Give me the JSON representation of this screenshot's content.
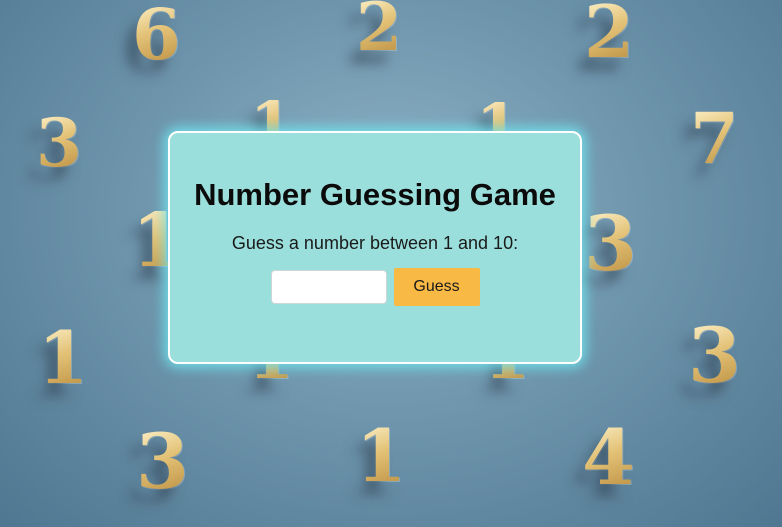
{
  "game": {
    "title": "Number Guessing Game",
    "prompt": "Guess a number between 1 and 10:",
    "input_value": "",
    "input_placeholder": "",
    "button_label": "Guess"
  },
  "background": {
    "digits": [
      "6",
      "2",
      "2",
      "3",
      "1",
      "1",
      "7",
      "1",
      "3",
      "1",
      "1",
      "1",
      "3",
      "3",
      "1",
      "4"
    ]
  },
  "colors": {
    "card_background": "#9bdfdc",
    "card_glow": "#6ee6f0",
    "button_background": "#f8b945",
    "page_background": "#6f96ad"
  }
}
